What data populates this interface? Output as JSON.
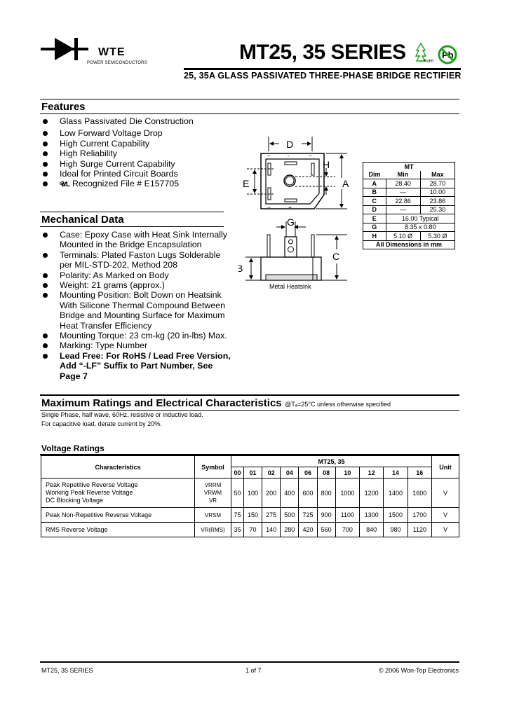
{
  "header": {
    "logo_text": "WTE",
    "logo_subtext": "POWER SEMICONDUCTORS",
    "title": "MT25, 35 SERIES",
    "subtitle": "25, 35A GLASS PASSIVATED THREE-PHASE BRIDGE RECTIFIER",
    "badges": [
      "RoHS",
      "Pb"
    ],
    "rohs_label": "RoHS",
    "pb_label": "Pb"
  },
  "features": {
    "title": "Features",
    "items": [
      "Glass Passivated Die Construction",
      "Low Forward Voltage Drop",
      "High Current Capability",
      "High Reliability",
      "High Surge Current Capability",
      "Ideal for Printed Circuit Boards",
      "Recognized File # E157705"
    ]
  },
  "mechanical": {
    "title": "Mechanical Data",
    "items": [
      "Case: Epoxy Case with Heat Sink Internally Mounted in the Bridge Encapsulation",
      "Terminals: Plated Faston Lugs Solderable per MIL-STD-202, Method 208",
      "Polarity: As Marked on Body",
      "Weight: 21 grams (approx.)",
      "Mounting Position: Bolt Down on Heatsink With Silicone Thermal Compound Between Bridge and Mounting Surface for Maximum Heat Transfer Efficiency",
      "Mounting Torque: 23 cm-kg (20 in-lbs) Max.",
      "Marking: Type Number",
      "Lead Free: For RoHS / Lead Free Version, Add “-LF” Suffix to Part Number, See Page 7"
    ]
  },
  "diagram": {
    "labels": {
      "D": "D",
      "H": "H",
      "E": "E",
      "A": "A",
      "G": "G",
      "B": "B",
      "C": "C"
    },
    "caption": "Metal Heatsink"
  },
  "dim_table": {
    "group": "MT",
    "headers": [
      "Dim",
      "Min",
      "Max"
    ],
    "rows": [
      {
        "dim": "A",
        "min": "28.40",
        "max": "28.70"
      },
      {
        "dim": "B",
        "min": "—",
        "max": "10.00"
      },
      {
        "dim": "C",
        "min": "22.86",
        "max": "23.86"
      },
      {
        "dim": "D",
        "min": "—",
        "max": "25.30"
      },
      {
        "dim": "E",
        "span": "16.00 Typical"
      },
      {
        "dim": "G",
        "span": "8.35 x 0.80"
      },
      {
        "dim": "H",
        "min": "5.10 Ø",
        "max": "5.30 Ø"
      }
    ],
    "footer": "All Dimensions in mm"
  },
  "ratings": {
    "title": "Maximum Ratings and Electrical Characteristics",
    "condition": "@Tₐ=25°C unless otherwise specified",
    "note1": "Single Phase, half wave, 60Hz, resistive or inductive load.",
    "note2": "For capacitive load, derate current by 20%."
  },
  "voltage": {
    "title": "Voltage Ratings",
    "col_char": "Characteristics",
    "col_symbol": "Symbol",
    "group": "MT25, 35",
    "col_unit": "Unit",
    "codes": [
      "00",
      "01",
      "02",
      "04",
      "06",
      "08",
      "10",
      "12",
      "14",
      "16"
    ],
    "rows": [
      {
        "chars": [
          "Peak Repetitive Reverse Voltage",
          "Working Peak Reverse Voltage",
          "DC Blocking Voltage"
        ],
        "symbols": [
          "VRRM",
          "VRWM",
          "VR"
        ],
        "values": [
          "50",
          "100",
          "200",
          "400",
          "600",
          "800",
          "1000",
          "1200",
          "1400",
          "1600"
        ],
        "unit": "V"
      },
      {
        "chars": [
          "Peak Non-Repetitive Reverse Voltage"
        ],
        "symbols": [
          "VRSM"
        ],
        "values": [
          "75",
          "150",
          "275",
          "500",
          "725",
          "900",
          "1100",
          "1300",
          "1500",
          "1700"
        ],
        "unit": "V"
      },
      {
        "chars": [
          "RMS Reverse Voltage"
        ],
        "symbols": [
          "VR(RMS)"
        ],
        "values": [
          "35",
          "70",
          "140",
          "280",
          "420",
          "560",
          "700",
          "840",
          "980",
          "1120"
        ],
        "unit": "V"
      }
    ]
  },
  "footer": {
    "left": "MT25, 35 SERIES",
    "center": "1 of 7",
    "right": "© 2006 Won-Top Electronics"
  }
}
